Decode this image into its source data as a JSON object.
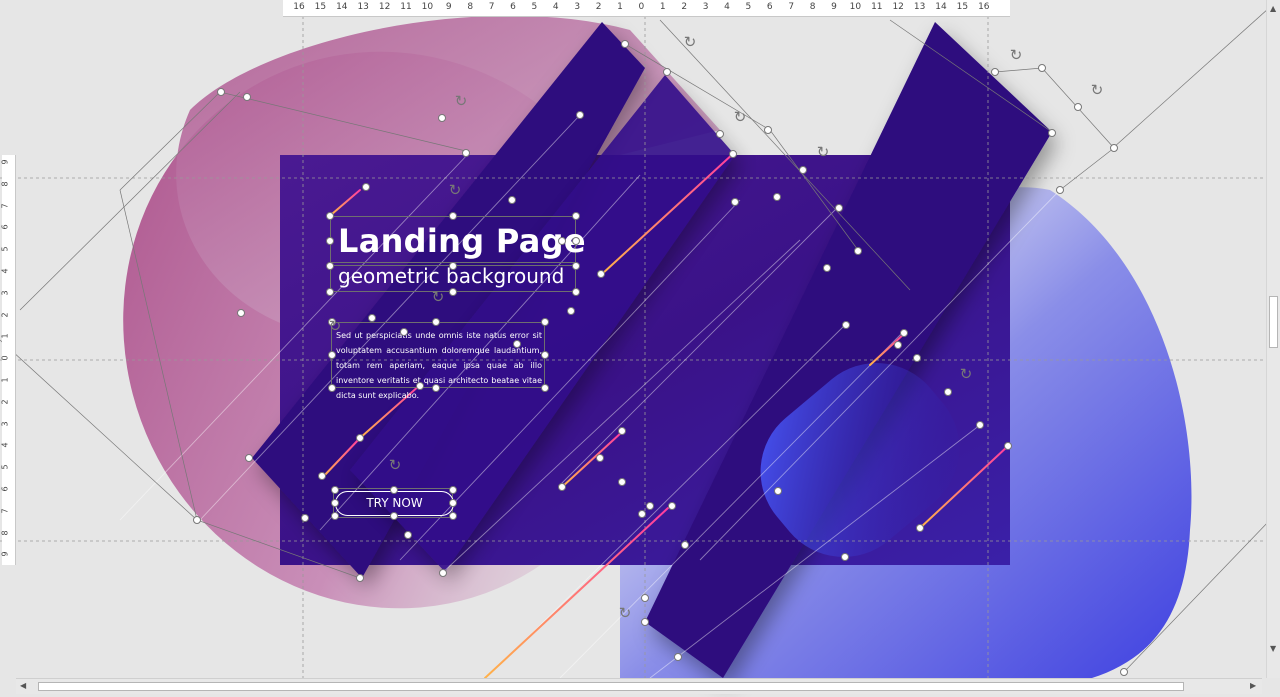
{
  "slide": {
    "title": "Landing Page",
    "subtitle": "geometric background",
    "body": "Sed ut perspiciatis unde omnis iste natus error sit voluptatem accusantium doloremque laudantium, totam rem aperiam, eaque ipsa quae ab illo inventore veritatis et quasi architecto beatae vitae dicta sunt explicabo.",
    "button_label": "TRY NOW"
  },
  "ruler": {
    "horizontal": [
      "16",
      "15",
      "14",
      "13",
      "12",
      "11",
      "10",
      "9",
      "8",
      "7",
      "6",
      "5",
      "4",
      "3",
      "2",
      "1",
      "0",
      "1",
      "2",
      "3",
      "4",
      "5",
      "6",
      "7",
      "8",
      "9",
      "10",
      "11",
      "12",
      "13",
      "14",
      "15",
      "16"
    ],
    "vertical": [
      "9",
      "8",
      "7",
      "6",
      "5",
      "4",
      "3",
      "2",
      "1",
      "0",
      "1",
      "2",
      "3",
      "4",
      "5",
      "6",
      "7",
      "8",
      "9"
    ]
  },
  "colors": {
    "canvas": "#e6e6e6",
    "slide_bg": "#3a1390",
    "band": "#2e0b7e",
    "pink_blob": "#b45c92",
    "blue_blob": "#4a4fe6",
    "accent_line": "#ff7a3c"
  },
  "icons": [
    "rotate-handle-icon",
    "scroll-arrow-up-icon",
    "scroll-arrow-down-icon",
    "scroll-arrow-left-icon",
    "scroll-arrow-right-icon"
  ]
}
